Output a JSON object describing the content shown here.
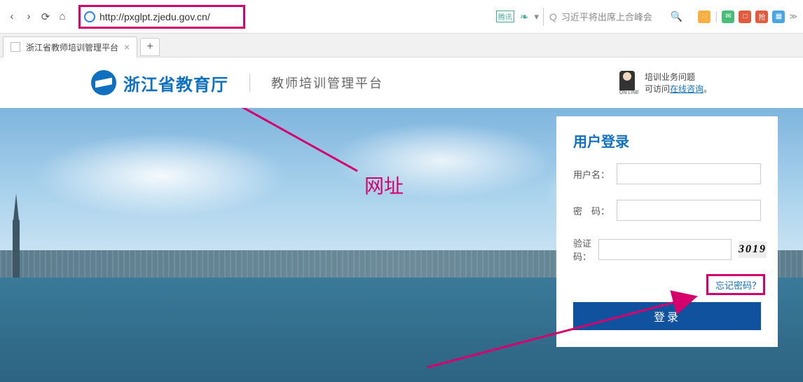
{
  "browser": {
    "url": "http://pxglpt.zjedu.gov.cn/",
    "search_hint": "习近平将出席上合峰会",
    "addr_tag": "腾讯"
  },
  "tab": {
    "title": "浙江省教师培训管理平台"
  },
  "header": {
    "org": "浙江省教育厅",
    "subtitle": "教师培训管理平台",
    "help_line1": "培训业务问题",
    "help_line2_prefix": "可访问",
    "help_line2_link": "在线咨询",
    "help_line2_suffix": "。",
    "avatar_caption": "ON LINE"
  },
  "login": {
    "title": "用户登录",
    "username_label": "用户名：",
    "password_label": "密　码：",
    "captcha_label": "验证码：",
    "captcha_value": "3019",
    "forgot": "忘记密码？",
    "submit": "登录"
  },
  "annotations": {
    "url_label": "网址"
  },
  "ext_colors": [
    "#4bbd7a",
    "#4bbd7a",
    "#e35b3e",
    "#e35b3e",
    "#4aa6e0"
  ]
}
